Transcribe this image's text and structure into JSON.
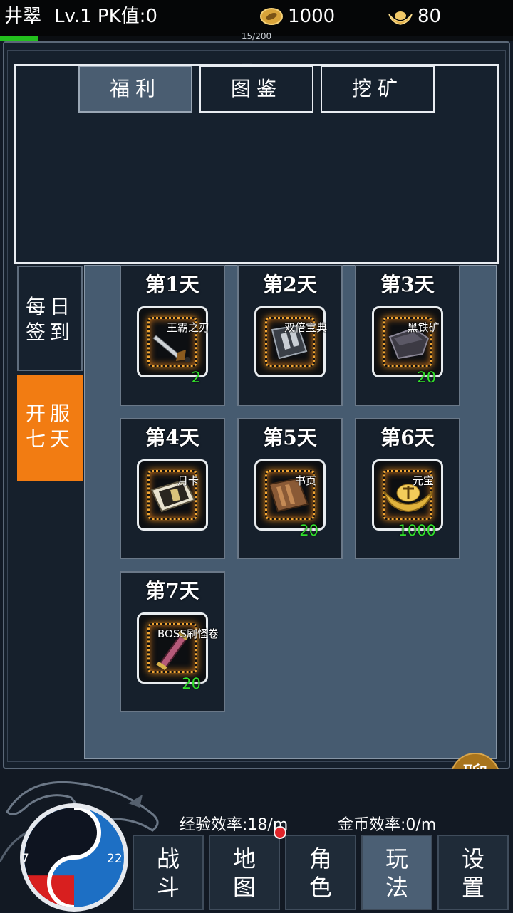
{
  "player": {
    "name": "井翠",
    "level_pk": "Lv.1 PK值:0",
    "gold": "1000",
    "ingot": "80",
    "exp_text": "15/200",
    "exp_progress": 0.075
  },
  "watermark": "玩",
  "tabs": [
    {
      "label": "福利",
      "active": true
    },
    {
      "label": "图鉴",
      "active": false
    },
    {
      "label": "挖矿",
      "active": false
    }
  ],
  "side_menu": [
    {
      "label_line1": "每日",
      "label_line2": "签到",
      "active": false
    },
    {
      "label_line1": "开服",
      "label_line2": "七天",
      "active": true
    }
  ],
  "rewards": [
    {
      "day": "第1天",
      "item": "王霸之刃",
      "qty": "2",
      "icon": "sword-icon"
    },
    {
      "day": "第2天",
      "item": "双倍宝典",
      "qty": "",
      "icon": "book-icon"
    },
    {
      "day": "第3天",
      "item": "黑铁矿",
      "qty": "20",
      "icon": "ore-icon"
    },
    {
      "day": "第4天",
      "item": "月卡",
      "qty": "",
      "icon": "month-card-icon"
    },
    {
      "day": "第5天",
      "item": "书页",
      "qty": "20",
      "icon": "page-icon"
    },
    {
      "day": "第6天",
      "item": "元宝",
      "qty": "1000",
      "icon": "ingot-icon"
    },
    {
      "day": "第7天",
      "item": "BOSS刷怪卷",
      "qty": "20",
      "icon": "scroll-icon"
    }
  ],
  "chat_label": "聊",
  "rates": {
    "exp": "经验效率:18/m",
    "gold": "金币效率:0/m"
  },
  "orb": {
    "hp": "7",
    "mp": "22",
    "hp_level": 0.32
  },
  "nav": [
    {
      "l1": "战",
      "l2": "斗",
      "active": false
    },
    {
      "l1": "地",
      "l2": "图",
      "active": false
    },
    {
      "l1": "角",
      "l2": "色",
      "active": false
    },
    {
      "l1": "玩",
      "l2": "法",
      "active": true
    },
    {
      "l1": "设",
      "l2": "置",
      "active": false
    }
  ],
  "colors": {
    "accent_orange": "#f27c12",
    "qty_green": "#31e02c",
    "xp_green": "#23c01e"
  }
}
